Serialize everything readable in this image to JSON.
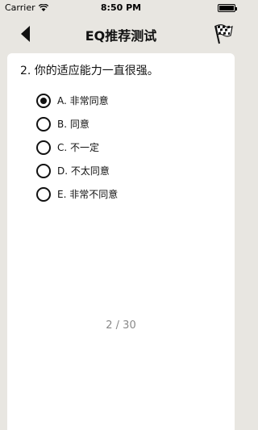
{
  "status_bar": {
    "carrier": "Carrier",
    "time": "8:50 PM"
  },
  "nav": {
    "title": "EQ推荐测试",
    "back_icon": "back-arrow-icon",
    "finish_icon": "checkered-flag-icon"
  },
  "question": {
    "text": "2. 你的适应能力一直很强。",
    "selected_index": 0,
    "options": [
      {
        "label": "A. 非常同意"
      },
      {
        "label": "B. 同意"
      },
      {
        "label": "C. 不一定"
      },
      {
        "label": "D. 不太同意"
      },
      {
        "label": "E. 非常不同意"
      }
    ]
  },
  "pager": {
    "text": "2 / 30"
  }
}
